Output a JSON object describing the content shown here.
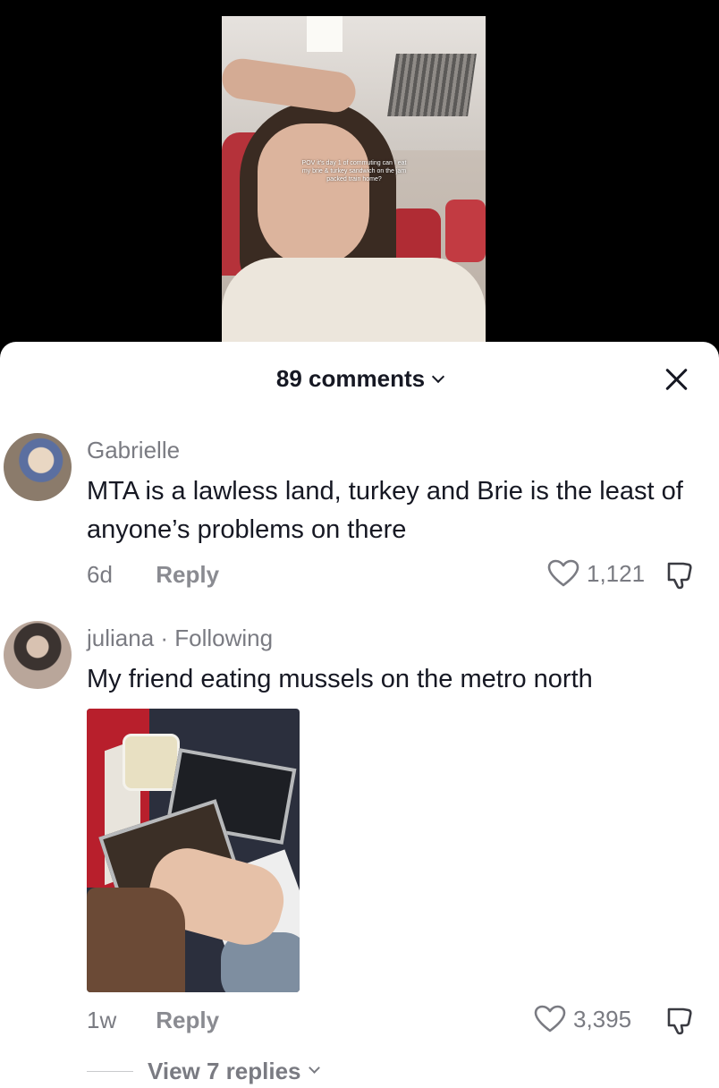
{
  "video": {
    "caption": "POV it's day 1 of commuting can I eat my brie & turkey sandwich on the jam packed train home?"
  },
  "sheet": {
    "title": "89 comments"
  },
  "comments": [
    {
      "username": "Gabrielle",
      "text": "MTA is a lawless land, turkey and Brie is the least of anyone’s problems on there",
      "time": "6d",
      "reply_label": "Reply",
      "likes": "1,121"
    },
    {
      "username": "juliana · Following",
      "text": "My friend eating mussels on the metro north",
      "time": "1w",
      "reply_label": "Reply",
      "likes": "3,395",
      "view_replies": "View 7 replies"
    }
  ],
  "icons": {
    "close": "close-icon",
    "heart": "heart-icon",
    "dislike": "thumbs-down-icon",
    "chevron": "chevron-down-icon"
  }
}
